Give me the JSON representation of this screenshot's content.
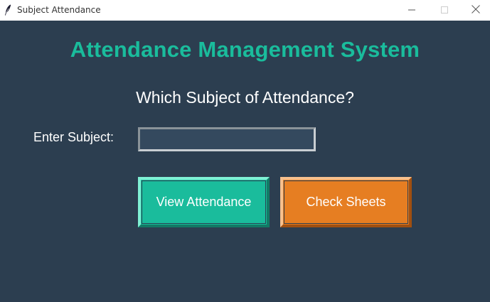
{
  "window": {
    "title": "Subject Attendance",
    "app_icon": "feather-icon",
    "controls": [
      "minimize-icon",
      "maximize-icon",
      "close-icon"
    ]
  },
  "main": {
    "heading": "Attendance Management System",
    "question": "Which Subject of Attendance?",
    "subject_label": "Enter Subject:",
    "subject_value": "",
    "view_button_label": "View Attendance",
    "check_button_label": "Check Sheets"
  },
  "colors": {
    "background": "#2c3e50",
    "heading": "#1abc9c",
    "view_button": "#1abc9c",
    "check_button": "#e67e22",
    "input_background": "#34495e"
  }
}
